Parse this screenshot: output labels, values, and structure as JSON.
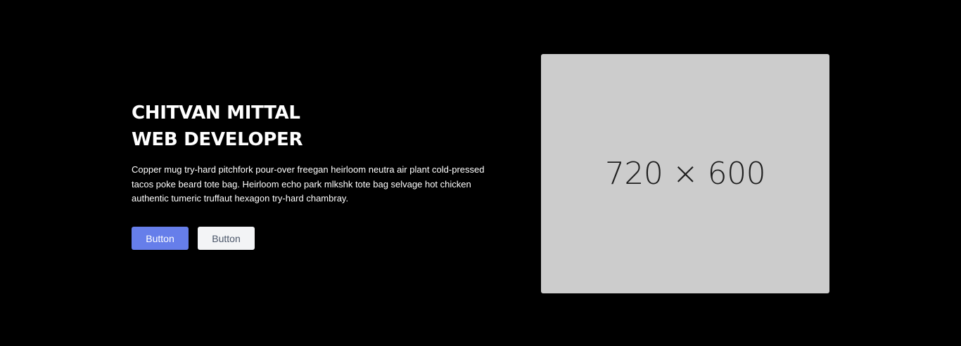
{
  "hero": {
    "title_line1": "CHITVAN MITTAL",
    "title_line2": "WEB DEVELOPER",
    "description": "Copper mug try-hard pitchfork pour-over freegan heirloom neutra air plant cold-pressed tacos poke beard tote bag. Heirloom echo park mlkshk tote bag selvage hot chicken authentic tumeric truffaut hexagon try-hard chambray.",
    "primary_button_label": "Button",
    "secondary_button_label": "Button",
    "image_placeholder_text": "720 × 600"
  },
  "colors": {
    "background": "#000000",
    "text": "#ffffff",
    "primary_button": "#667eea",
    "secondary_button": "#f3f4f6",
    "placeholder_bg": "#cccccc"
  }
}
